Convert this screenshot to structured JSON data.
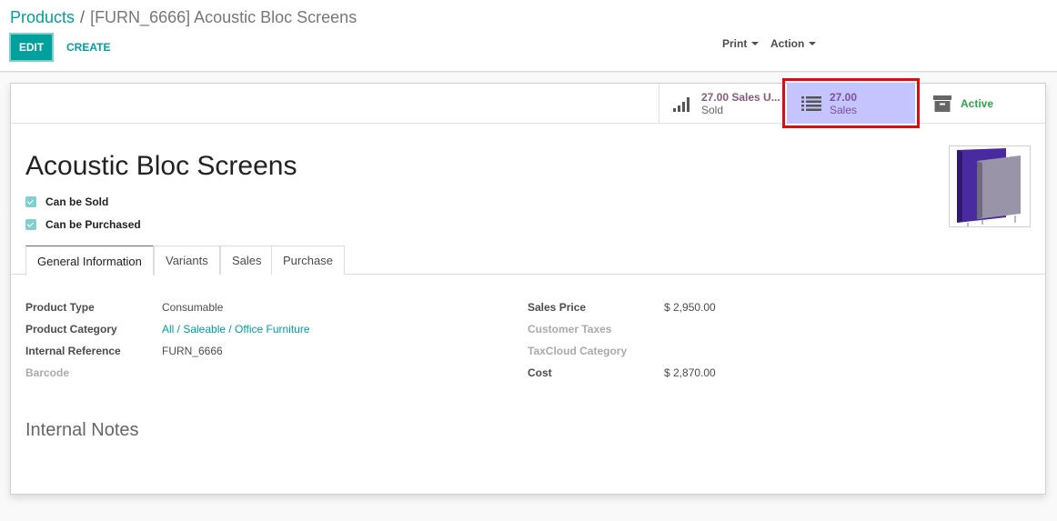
{
  "breadcrumb": {
    "parent": "Products",
    "separator": "/",
    "current": "[FURN_6666] Acoustic Bloc Screens"
  },
  "toolbar": {
    "edit_label": "EDIT",
    "create_label": "CREATE",
    "print_label": "Print",
    "action_label": "Action"
  },
  "smart_buttons": {
    "sold": {
      "value": "27.00 Sales U...",
      "label": "Sold",
      "icon": "signal-bars-icon"
    },
    "sales": {
      "value": "27.00",
      "label": "Sales",
      "icon": "list-icon"
    },
    "active": {
      "label": "Active",
      "icon": "archive-box-icon"
    }
  },
  "product": {
    "name": "Acoustic Bloc Screens",
    "can_be_sold_label": "Can be Sold",
    "can_be_purchased_label": "Can be Purchased"
  },
  "tabs": [
    {
      "label": "General Information"
    },
    {
      "label": "Variants"
    },
    {
      "label": "Sales"
    },
    {
      "label": "Purchase"
    }
  ],
  "general": {
    "left": [
      {
        "label": "Product Type",
        "value": "Consumable"
      },
      {
        "label": "Product Category",
        "value": "All / Saleable / Office Furniture"
      },
      {
        "label": "Internal Reference",
        "value": "FURN_6666"
      },
      {
        "label": "Barcode",
        "value": ""
      }
    ],
    "right": [
      {
        "label": "Sales Price",
        "value": "$ 2,950.00"
      },
      {
        "label": "Customer Taxes",
        "value": ""
      },
      {
        "label": "TaxCloud Category",
        "value": ""
      },
      {
        "label": "Cost",
        "value": "$ 2,870.00"
      }
    ]
  },
  "notes": {
    "title": "Internal Notes"
  },
  "colors": {
    "primary": "#00a09d",
    "brand_purple": "#875a7b",
    "highlight_border": "#e00b0b",
    "highlight_fill": "#c4c4ff",
    "active_green": "#28a745"
  }
}
